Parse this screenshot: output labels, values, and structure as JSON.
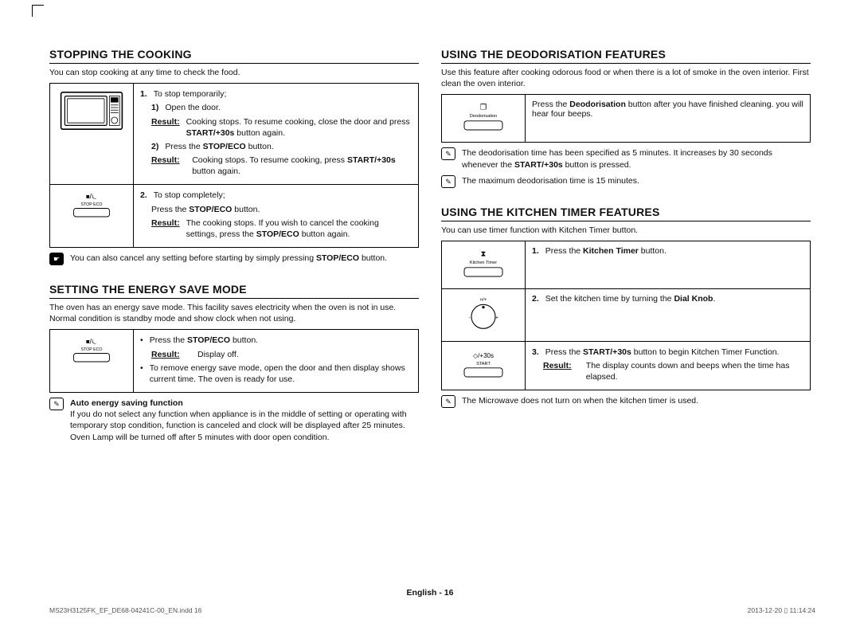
{
  "left": {
    "stopping": {
      "heading": "STOPPING THE COOKING",
      "intro": "You can stop cooking at any time to check the food.",
      "row1": {
        "s1": "To stop temporarily;",
        "a1": "Open the door.",
        "r1": "Cooking stops. To resume cooking, close the door and press ",
        "r1b": "START/+30s",
        "r1c": " button again.",
        "a2a": "Press the ",
        "a2b": "STOP/ECO",
        "a2c": " button.",
        "r2a": "Cooking stops. To resume cooking, press ",
        "r2b": "START/+30s",
        "r2c": " button again."
      },
      "row2": {
        "s1": "To stop completely;",
        "a": "Press the ",
        "ab": "STOP/ECO",
        "ac": " button.",
        "r1": "The cooking stops. If you wish to cancel the cooking settings, press the ",
        "r1b": "STOP/ECO",
        "r1c": " button again."
      },
      "note": {
        "a": "You can also cancel any setting before starting by simply pressing ",
        "b": "STOP/ECO",
        "c": " button."
      },
      "btn_label": "STOP  ECO",
      "btn_glyph": "⏹/⏾"
    },
    "energy": {
      "heading": "SETTING THE ENERGY SAVE MODE",
      "intro": "The oven has an energy save mode. This facility saves electricity when the oven is not in use. Normal condition is standby mode and show clock when not using.",
      "b1a": "Press the ",
      "b1b": "STOP/ECO",
      "b1c": " button.",
      "b1r": "Display off.",
      "b2": "To remove energy save mode, open the door and then display shows current time. The oven is ready for use.",
      "auto_title": "Auto energy saving function",
      "auto_p1": "If you do not select any function when appliance is in the middle of setting or operating with temporary stop condition, function is canceled and clock will be displayed after 25 minutes.",
      "auto_p2": "Oven Lamp will be turned off after 5 minutes with door open condition."
    }
  },
  "right": {
    "deo": {
      "heading": "USING THE DEODORISATION FEATURES",
      "intro": "Use this feature after cooking odorous food or when there is a lot of smoke in the oven interior. First clean the oven interior.",
      "btn_label": "Deodorisation",
      "btn_glyph": "❒",
      "ta": "Press the ",
      "tb": "Deodorisation",
      "tc": " button after you have finished cleaning. you will hear four beeps.",
      "n1a": "The deodorisation time has been specified as 5 minutes. It increases by 30 seconds whenever the ",
      "n1b": "START/+30s",
      "n1c": " button is pressed.",
      "n2": "The maximum deodorisation time is 15 minutes."
    },
    "timer": {
      "heading": "USING THE KITCHEN TIMER FEATURES",
      "intro": "You can use timer function with Kitchen Timer button.",
      "btn_label": "Kitchen Timer",
      "btn_glyph": "⧗",
      "knob_label": "ʜ/+",
      "start_label": "START",
      "start_sym": "◇/+30s",
      "s1a": "Press the ",
      "s1b": "Kitchen Timer",
      "s1c": " button.",
      "s2a": "Set the kitchen time by turning the ",
      "s2b": "Dial Knob",
      "s2c": ".",
      "s3a": "Press the ",
      "s3b": "START/+30s",
      "s3c": " button to begin Kitchen Timer Function.",
      "s3r": "The display counts down and beeps when the time has elapsed.",
      "note": "The Microwave does not turn on when the kitchen timer is used."
    }
  },
  "labels": {
    "result": "Result:",
    "num1": "1.",
    "num2": "2.",
    "num3": "3.",
    "sub1": "1)",
    "sub2": "2)"
  },
  "footer": {
    "page": "English - 16",
    "file": "MS23H3125FK_EF_DE68-04241C-00_EN.indd   16",
    "ts": "2013-12-20   ▯ 11:14:24"
  }
}
